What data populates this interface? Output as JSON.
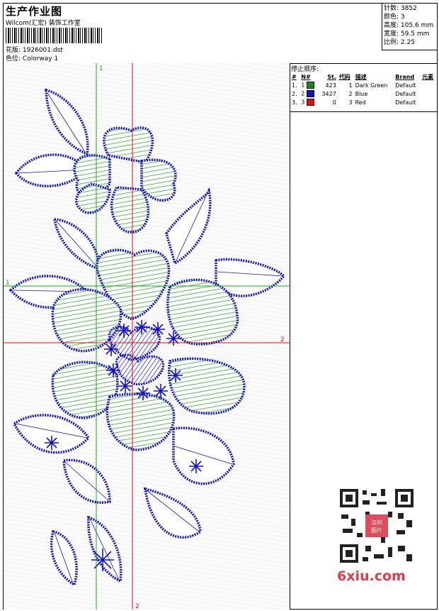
{
  "header": {
    "title": "生产作业图",
    "company": "Wilcom(汇宏) 装饰工作室",
    "design_label": "花版:",
    "design_file": "1926001.dst",
    "colorway_label": "色位:",
    "colorway_value": "Colorway 1"
  },
  "stats": [
    {
      "label": "针数:",
      "value": "3852"
    },
    {
      "label": "颜色:",
      "value": "3"
    },
    {
      "label": "高度:",
      "value": "105.6 mm"
    },
    {
      "label": "宽度:",
      "value": "59.5 mm"
    },
    {
      "label": "比例:",
      "value": "2.25"
    }
  ],
  "stop_sequence": {
    "title": "停止顺序:",
    "columns": [
      "#",
      "N#",
      "St.",
      "代码",
      "描述",
      "Brand",
      "元素"
    ],
    "rows": [
      {
        "index": "1.",
        "needle": "1",
        "stitches": "423",
        "code": "1",
        "description": "Dark Green",
        "brand": "Default",
        "color": "#1a8a1a"
      },
      {
        "index": "2.",
        "needle": "2",
        "stitches": "3427",
        "code": "2",
        "description": "Blue",
        "brand": "Default",
        "color": "#1010d0"
      },
      {
        "index": "3.",
        "needle": "3",
        "stitches": "0",
        "code": "3",
        "description": "Red",
        "brand": "Default",
        "color": "#e01010"
      }
    ]
  },
  "markers": {
    "top": "1",
    "left": "1",
    "right": "2",
    "bottom": "2"
  },
  "colors": {
    "outline": "#1010d0",
    "fill": "#1a9a1a",
    "crosshair_red": "#e01010",
    "crosshair_green": "#10b010"
  },
  "watermark": {
    "text": "6xiu.com",
    "stamp": "汉印图片"
  }
}
